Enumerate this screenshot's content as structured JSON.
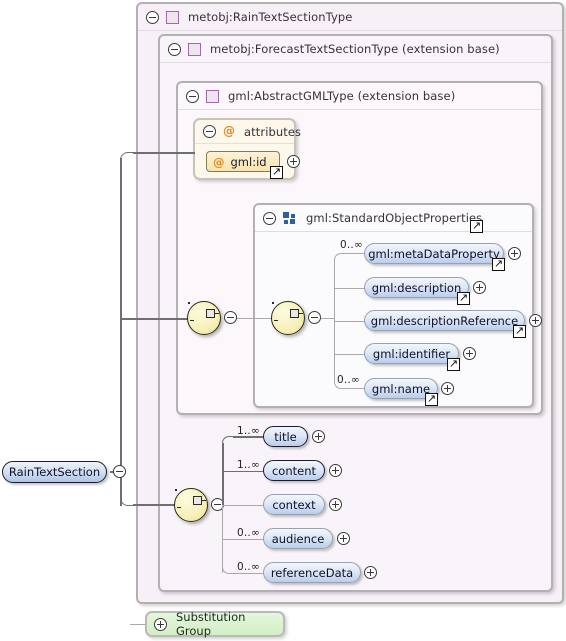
{
  "diagram": {
    "kind": "xml-schema-element-diagram",
    "root_element": {
      "label": "RainTextSection",
      "occurrence": "",
      "toggle": "minus"
    },
    "substitution_group": {
      "label": "Substitution Group",
      "toggle": "plus"
    }
  },
  "types": {
    "outer": {
      "label": "metobj:RainTextSectionType",
      "icon": "complex-type-icon",
      "toggle": "minus"
    },
    "mid": {
      "label": "metobj:ForecastTextSectionType (extension base)",
      "icon": "complex-type-icon",
      "toggle": "minus"
    },
    "inner": {
      "label": "gml:AbstractGMLType (extension base)",
      "icon": "complex-type-icon",
      "toggle": "minus"
    },
    "group": {
      "label": "gml:StandardObjectProperties",
      "icon": "model-group-icon",
      "toggle": "minus"
    }
  },
  "attributes_box": {
    "label": "attributes",
    "icon": "attribute-icon",
    "toggle": "minus",
    "items": [
      {
        "label": "gml:id",
        "icon": "attribute-icon",
        "toggle": "plus",
        "link": true
      }
    ]
  },
  "gml_sequence": {
    "toggle": "minus",
    "children": [
      {
        "label": "gml:metaDataProperty",
        "occurrence": "0..∞",
        "required": false,
        "toggle": "plus",
        "link": true
      },
      {
        "label": "gml:description",
        "occurrence": "",
        "required": false,
        "toggle": "plus",
        "link": true
      },
      {
        "label": "gml:descriptionReference",
        "occurrence": "",
        "required": false,
        "toggle": "plus",
        "link": true
      },
      {
        "label": "gml:identifier",
        "occurrence": "",
        "required": false,
        "toggle": "plus",
        "link": true
      },
      {
        "label": "gml:name",
        "occurrence": "0..∞",
        "required": false,
        "toggle": "plus",
        "link": true
      }
    ]
  },
  "body_sequence": {
    "toggle": "minus",
    "children": [
      {
        "label": "title",
        "occurrence": "1..∞",
        "required": true,
        "toggle": "plus",
        "link": false
      },
      {
        "label": "content",
        "occurrence": "1..∞",
        "required": true,
        "toggle": "plus",
        "link": false
      },
      {
        "label": "context",
        "occurrence": "",
        "required": false,
        "toggle": "plus",
        "link": false
      },
      {
        "label": "audience",
        "occurrence": "0..∞",
        "required": false,
        "toggle": "plus",
        "link": false
      },
      {
        "label": "referenceData",
        "occurrence": "0..∞",
        "required": false,
        "toggle": "plus",
        "link": false
      }
    ]
  },
  "colors": {
    "outer_type_bg": "#f7f1f7",
    "mid_type_bg": "#f9f4f9",
    "inner_type_bg": "#fbf7fb",
    "group_bg": "#fbfbfe",
    "attribute_bg": "#fdf7ec",
    "element_fill": "#b9cdec",
    "sequence_fill": "#f7f0b8",
    "substitution_bg": "#d3efc6",
    "type_icon": "#a06aa8",
    "attribute_accent": "#e08a20",
    "group_icon": "#2d5fa8",
    "connector": "#a9a9a9"
  }
}
